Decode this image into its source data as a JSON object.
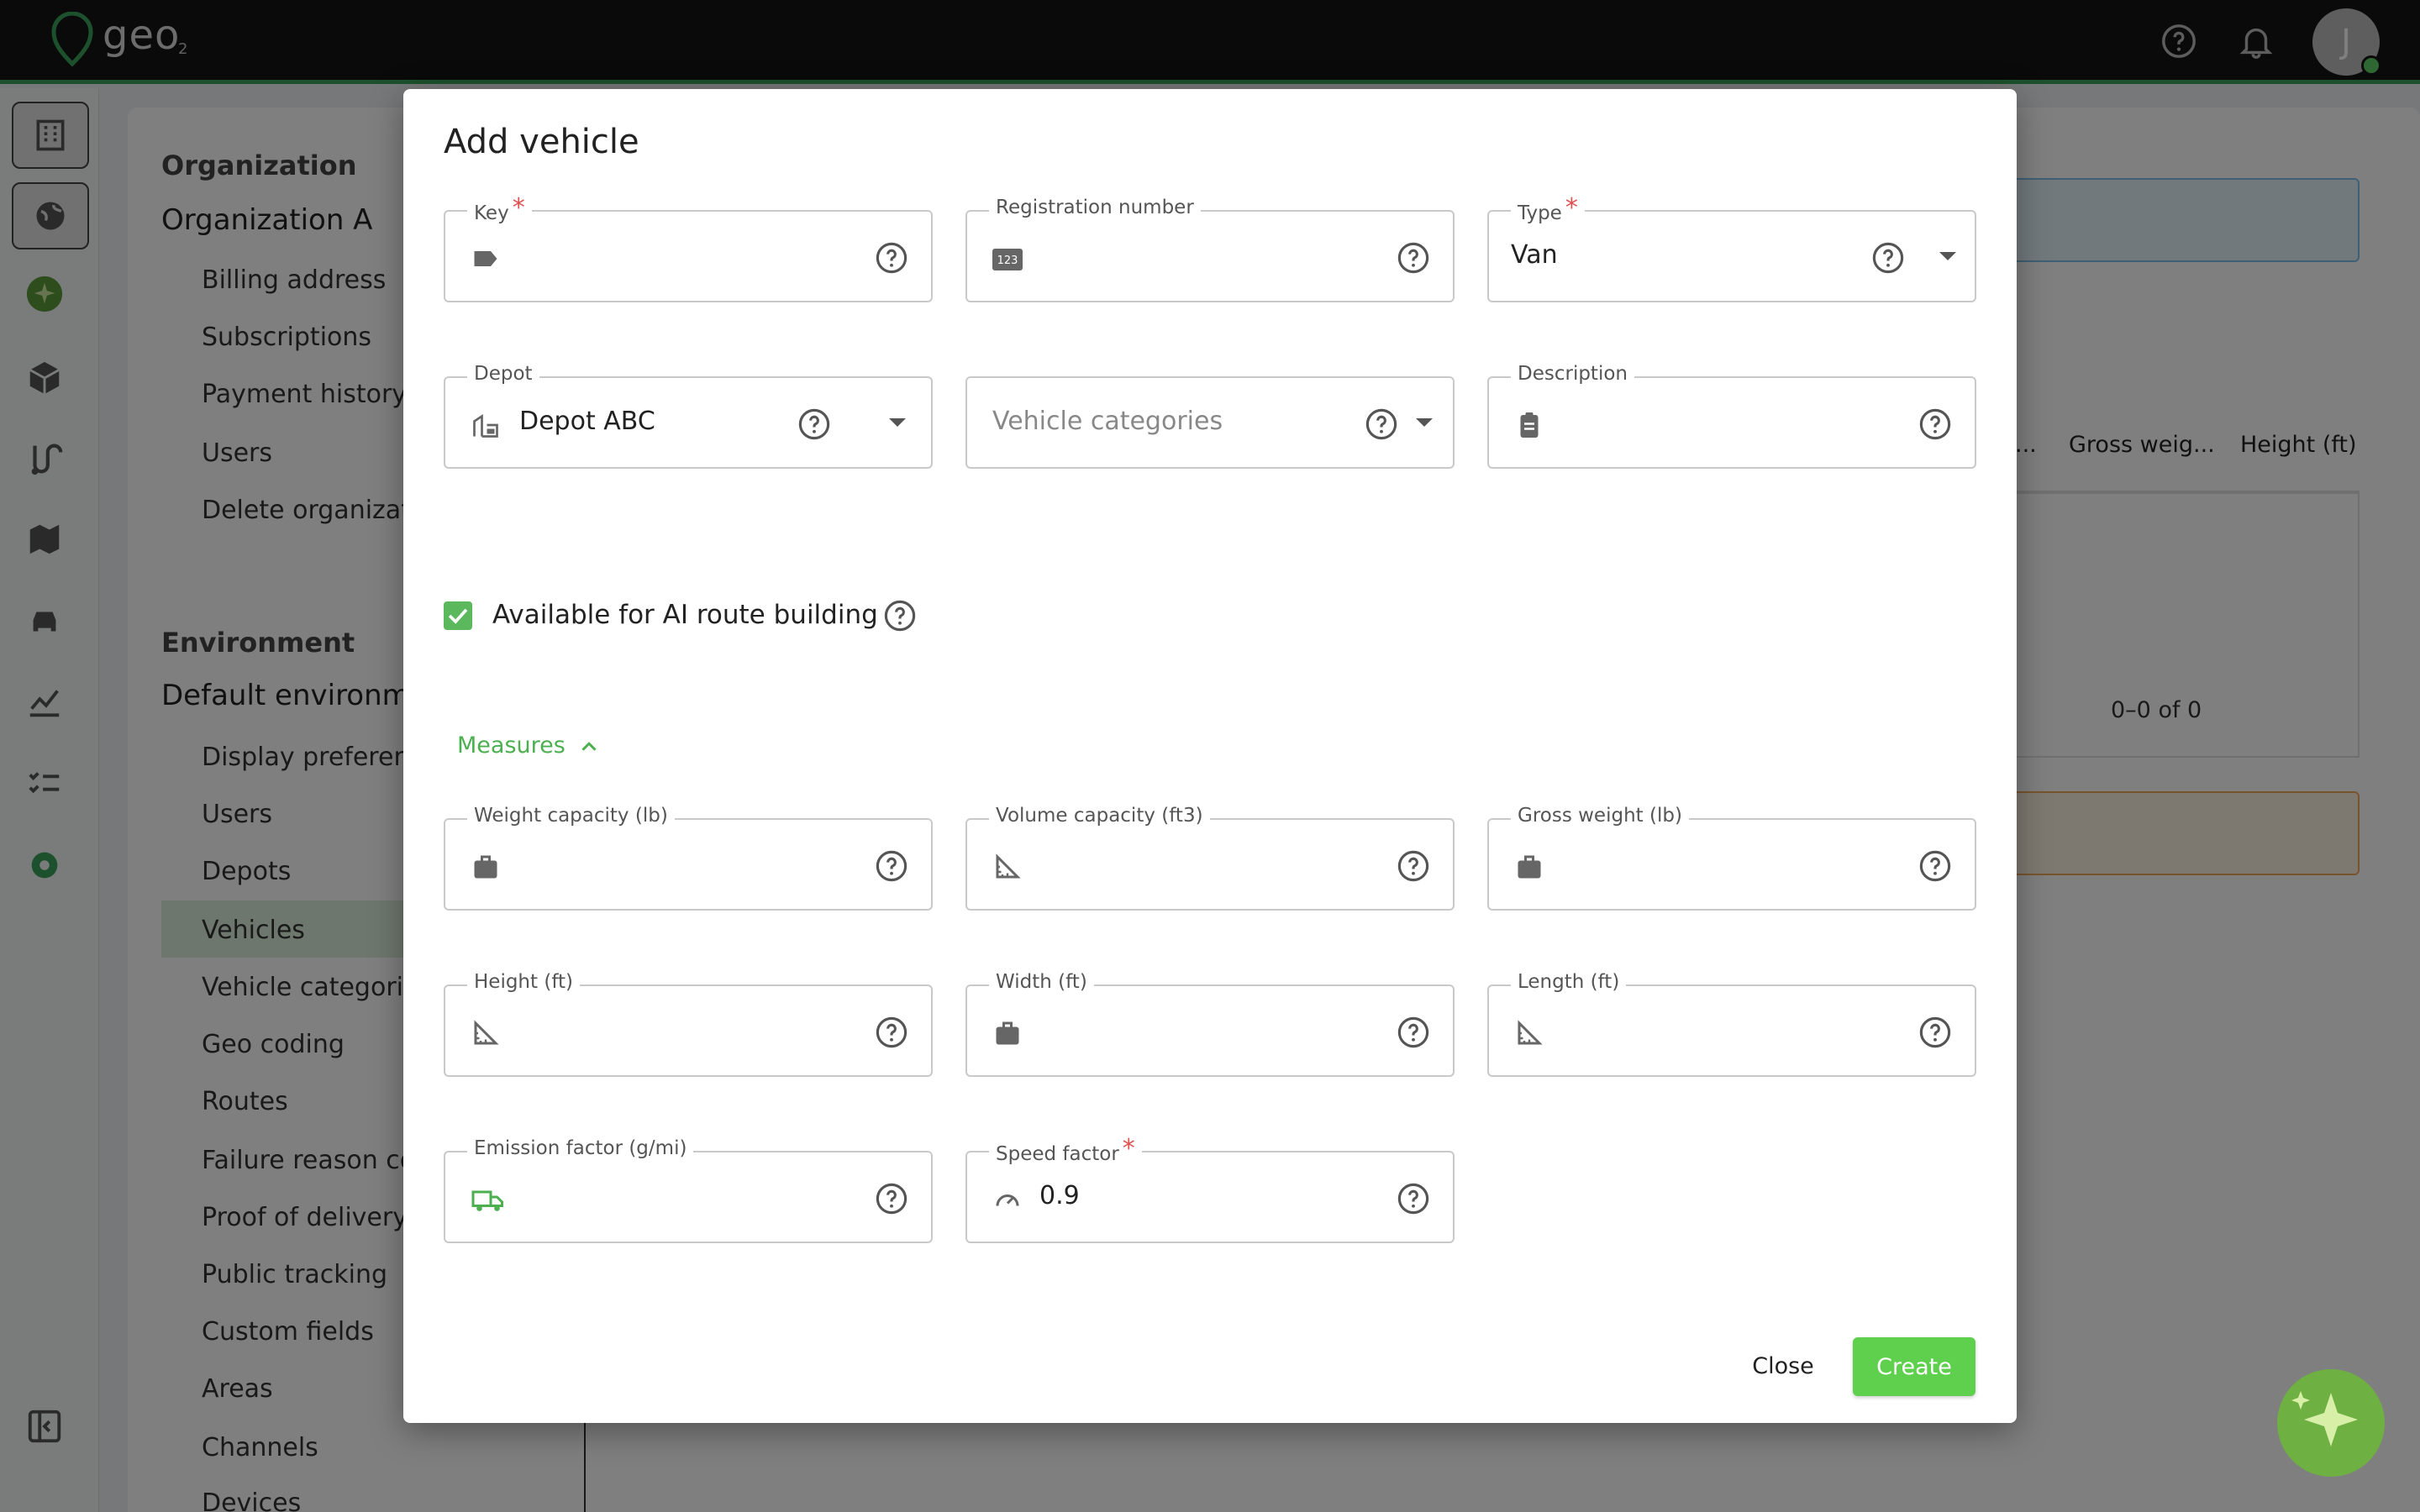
{
  "app": {
    "logo_text": "geo",
    "logo_sub": "2",
    "avatar_initial": "J"
  },
  "sidebar": {
    "organization_title": "Organization",
    "organization_name": "Organization A",
    "org_items": [
      "Billing address",
      "Subscriptions",
      "Payment history",
      "Users",
      "Delete organizati"
    ],
    "environment_title": "Environment",
    "environment_name": "Default environmen",
    "env_items": [
      "Display preferenc",
      "Users",
      "Depots",
      "Vehicles",
      "Vehicle categorie",
      "Geo coding",
      "Routes",
      "Failure reason co",
      "Proof of delivery",
      "Public tracking",
      "Custom fields",
      "Areas",
      "Channels",
      "Devices"
    ]
  },
  "background_table": {
    "columns": [
      "...",
      "Gross weig...",
      "Height (ft)"
    ],
    "pager": "0–0 of 0"
  },
  "dialog": {
    "title": "Add vehicle",
    "fields": {
      "key": {
        "label": "Key",
        "required": "*",
        "value": ""
      },
      "registration": {
        "label": "Registration number",
        "value": "",
        "icon_text": "123"
      },
      "type": {
        "label": "Type",
        "required": "*",
        "value": "Van"
      },
      "depot": {
        "label": "Depot",
        "value": "Depot ABC"
      },
      "vehicle_categories": {
        "placeholder": "Vehicle categories"
      },
      "description": {
        "label": "Description",
        "value": ""
      },
      "weight_capacity": {
        "label": "Weight capacity (lb)",
        "value": ""
      },
      "volume_capacity": {
        "label": "Volume capacity (ft3)",
        "value": ""
      },
      "gross_weight": {
        "label": "Gross weight (lb)",
        "value": ""
      },
      "height": {
        "label": "Height (ft)",
        "value": ""
      },
      "width": {
        "label": "Width (ft)",
        "value": ""
      },
      "length": {
        "label": "Length (ft)",
        "value": ""
      },
      "emission_factor": {
        "label": "Emission factor (g/mi)",
        "value": ""
      },
      "speed_factor": {
        "label": "Speed factor",
        "required": "*",
        "value": "0.9"
      }
    },
    "ai_checkbox": {
      "label": "Available for AI route building",
      "checked": true
    },
    "measures_toggle": "Measures",
    "close_label": "Close",
    "create_label": "Create"
  },
  "colors": {
    "accent": "#5fcf4e",
    "topbar": "#141414",
    "required": "#e05050"
  }
}
